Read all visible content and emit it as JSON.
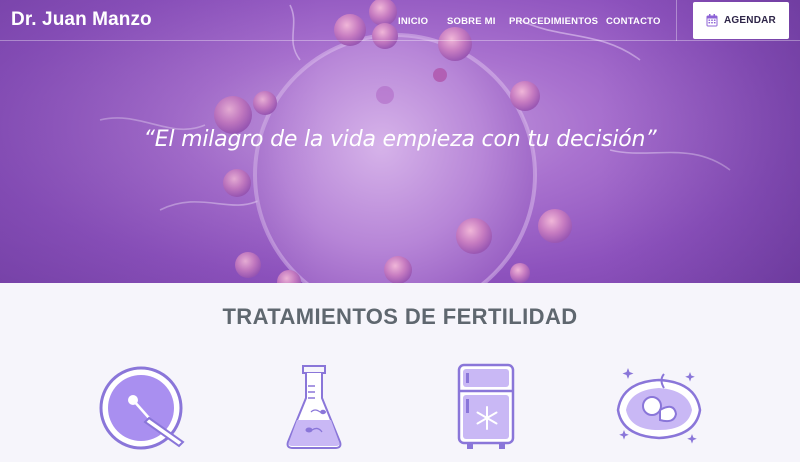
{
  "header": {
    "brand": "Dr. Juan Manzo",
    "menu": [
      {
        "label": "INICIO"
      },
      {
        "label": "SOBRE MI"
      },
      {
        "label": "PROCEDIMIENTOS"
      },
      {
        "label": "CONTACTO"
      }
    ],
    "cta": {
      "label": "AGENDAR",
      "icon": "calendar-icon"
    }
  },
  "hero": {
    "quote": "“El milagro de la vida empieza con tu decisión”"
  },
  "treatments": {
    "title": "TRATAMIENTOS DE FERTILIDAD",
    "items": [
      {
        "icon": "icsi-injection-icon",
        "label": ""
      },
      {
        "icon": "flask-sperm-icon",
        "label": ""
      },
      {
        "icon": "freezer-icon",
        "label": ""
      },
      {
        "icon": "ultrasound-baby-icon",
        "label": ""
      }
    ]
  },
  "colors": {
    "accent": "#8d52bd",
    "icon_fill": "#a98ff0",
    "icon_stroke": "#7a62d6",
    "title_text": "#5f676f"
  }
}
